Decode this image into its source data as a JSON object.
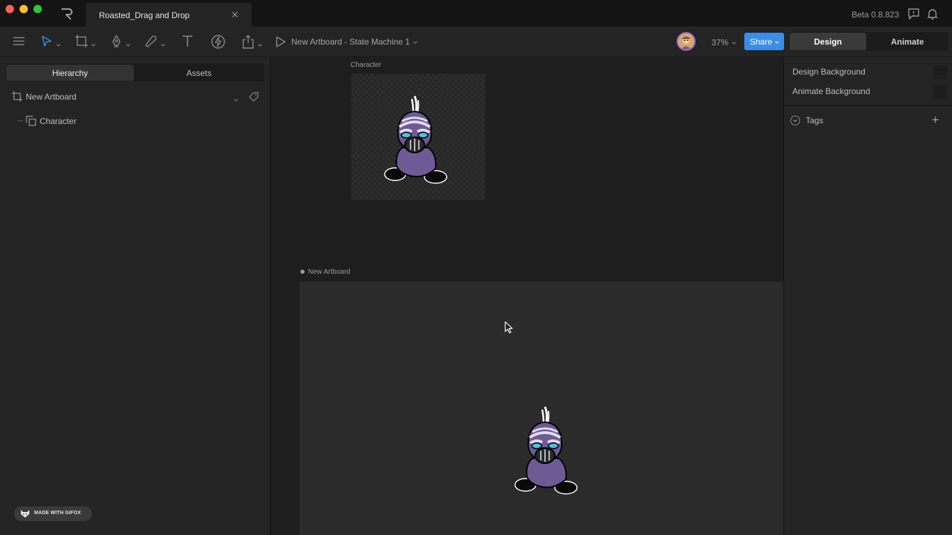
{
  "window": {
    "tab_title": "Roasted_Drag and Drop",
    "tab_close": "✕",
    "version": "Beta 0.8.823"
  },
  "toolbar": {
    "state_machine_title": "New Artboard - State Machine 1",
    "zoom": "37%",
    "share_label": "Share",
    "mode_design": "Design",
    "mode_animate": "Animate",
    "icons": [
      "menu-icon",
      "select-tool-icon",
      "artboard-tool-icon",
      "pen-tool-icon",
      "shape-tool-icon",
      "text-tool-icon",
      "bolt-icon",
      "export-icon",
      "play-icon"
    ]
  },
  "left_panel": {
    "tabs": [
      "Hierarchy",
      "Assets"
    ],
    "hierarchy": [
      {
        "label": "New Artboard",
        "icon": "artboard-icon"
      },
      {
        "label": "Character",
        "icon": "group-icon"
      }
    ],
    "badge": "MADE WITH GIFOX"
  },
  "canvas": {
    "character_label": "Character",
    "new_artboard_label": "New Artboard"
  },
  "right_panel": {
    "design_background": "Design Background",
    "animate_background": "Animate Background",
    "tags": "Tags",
    "tags_add": "+"
  },
  "colors": {
    "accent": "#3b8ee8",
    "panel": "#242424",
    "canvas": "#1e1e1e",
    "character_purple": "#6e5a95"
  }
}
